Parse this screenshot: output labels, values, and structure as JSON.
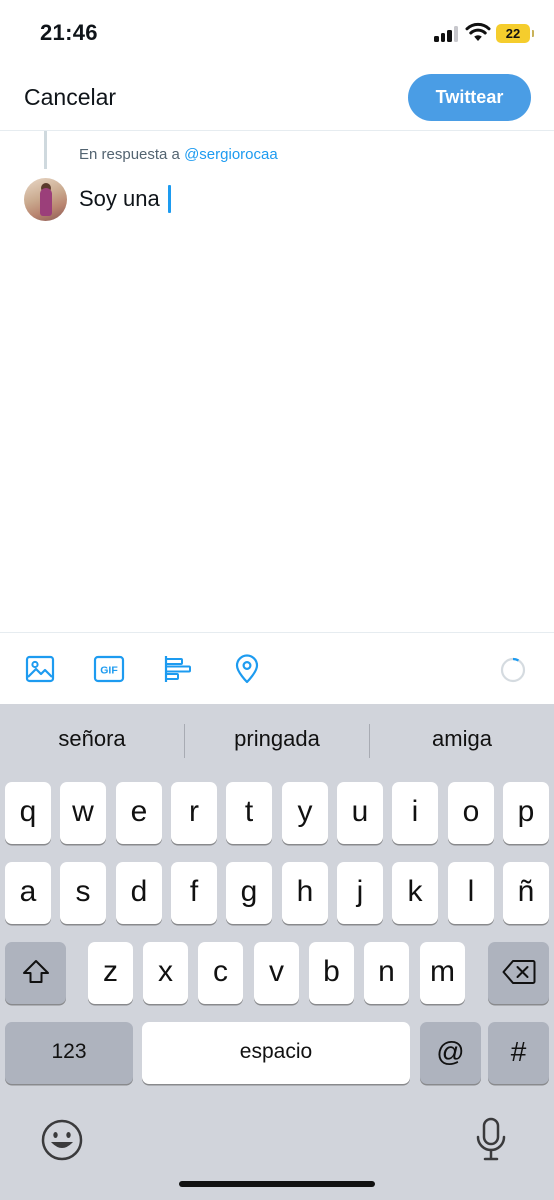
{
  "status_bar": {
    "time": "21:46",
    "battery_level": "22"
  },
  "header": {
    "cancel_label": "Cancelar",
    "tweet_button_label": "Twittear"
  },
  "compose": {
    "reply_prefix": "En respuesta a",
    "reply_handle": "@sergiorocaa",
    "text": "Soy una"
  },
  "toolbar": {
    "icons": [
      "image-icon",
      "gif-icon",
      "poll-icon",
      "location-icon"
    ],
    "gif_label": "GIF"
  },
  "keyboard": {
    "suggestions": [
      "señora",
      "pringada",
      "amiga"
    ],
    "row1": [
      "q",
      "w",
      "e",
      "r",
      "t",
      "y",
      "u",
      "i",
      "o",
      "p"
    ],
    "row2": [
      "a",
      "s",
      "d",
      "f",
      "g",
      "h",
      "j",
      "k",
      "l",
      "ñ"
    ],
    "row3": [
      "z",
      "x",
      "c",
      "v",
      "b",
      "n",
      "m"
    ],
    "numbers_label": "123",
    "space_label": "espacio",
    "at_label": "@",
    "hash_label": "#"
  },
  "colors": {
    "accent": "#1d9bf0",
    "tweet_button": "#4a9de5",
    "keyboard_bg": "#d1d4db",
    "battery": "#f5cd2d"
  }
}
